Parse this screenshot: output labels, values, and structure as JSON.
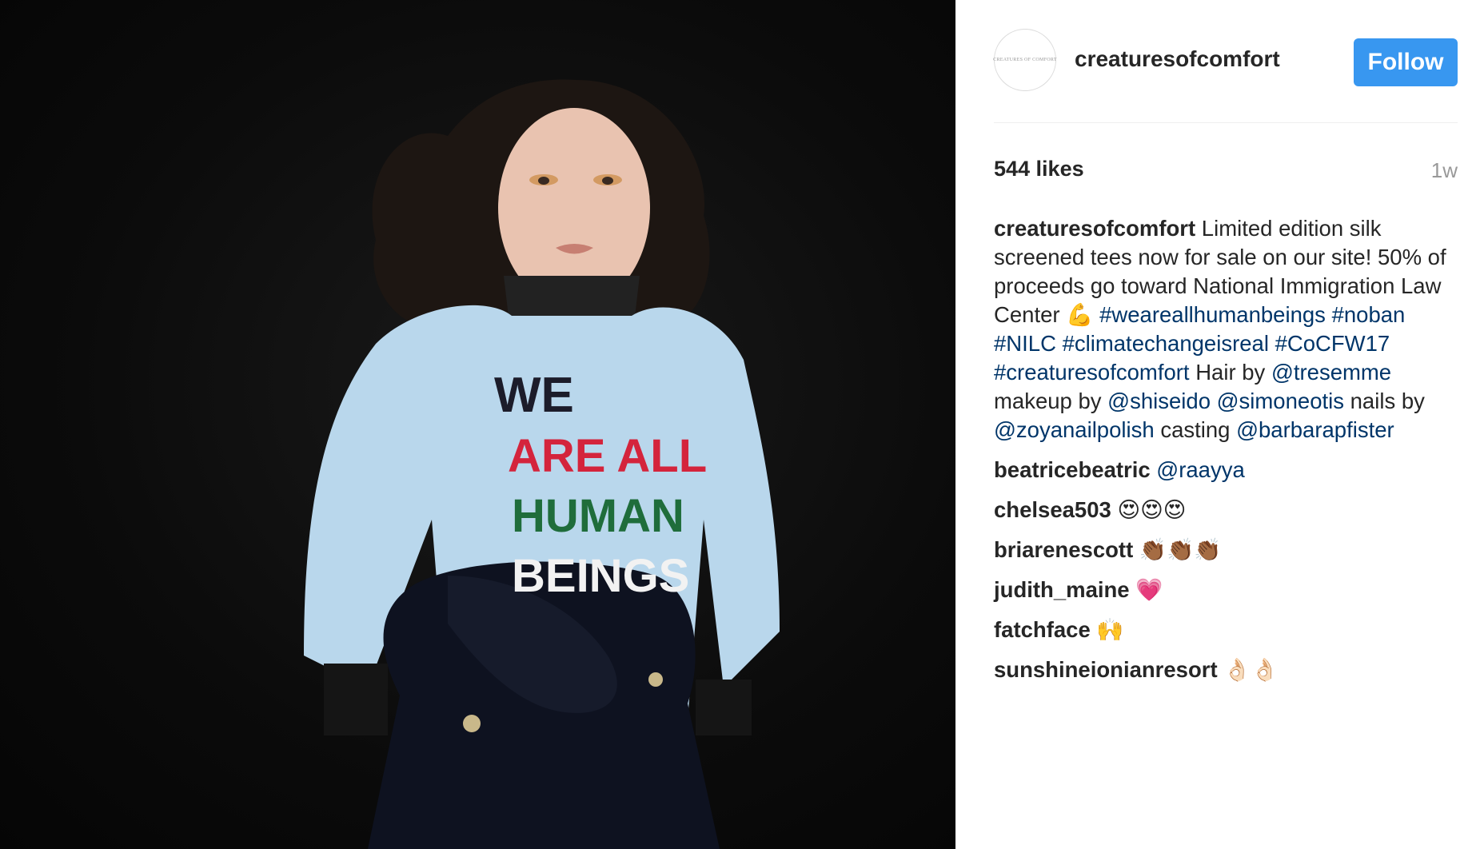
{
  "post": {
    "username": "creaturesofcomfort",
    "avatar_text": "CREATURES of COMFORT",
    "follow_label": "Follow",
    "likes": "544 likes",
    "time": "1w",
    "photo_shirt_text": [
      "WE",
      "ARE ALL",
      "HUMAN",
      "BEINGS"
    ],
    "caption": {
      "text1": "Limited edition silk screened tees now for sale on our site! 50% of proceeds go toward National Immigration Law Center",
      "emoji1": "💪",
      "tag1": "#weareallhumanbeings",
      "tag2": "#noban",
      "tag3": "#NILC",
      "tag4": "#climatechangeisreal",
      "tag5": "#CoCFW17",
      "tag6": "#creaturesofcomfort",
      "text2": "Hair by",
      "mention1": "@tresemme",
      "text3": "makeup by",
      "mention2": "@shiseido",
      "mention3": "@simoneotis",
      "text4": "nails by",
      "mention4": "@zoyanailpolish",
      "text5": "casting",
      "mention5": "@barbarapfister"
    },
    "comments": [
      {
        "user": "beatricebeatric",
        "text": "@raayya",
        "is_link": true
      },
      {
        "user": "chelsea503",
        "text": "😍😍😍",
        "is_link": false
      },
      {
        "user": "briarenescott",
        "text": "👏🏾👏🏾👏🏾",
        "is_link": false
      },
      {
        "user": "judith_maine",
        "text": "💗",
        "is_link": false
      },
      {
        "user": "fatchface",
        "text": "🙌",
        "is_link": false
      },
      {
        "user": "sunshineionianresort",
        "text": "👌🏻👌🏻",
        "is_link": false
      }
    ]
  },
  "colors": {
    "follow_blue": "#3897f0",
    "link_blue": "#003569",
    "text_dark": "#262626",
    "muted": "#999999"
  }
}
